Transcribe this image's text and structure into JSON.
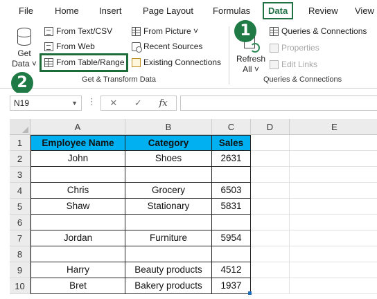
{
  "menu": {
    "tabs": [
      "File",
      "Home",
      "Insert",
      "Page Layout",
      "Formulas",
      "Data",
      "Review",
      "View"
    ],
    "active_tab": "Data"
  },
  "ribbon": {
    "get_data": {
      "line1": "Get",
      "line2": "Data ˅"
    },
    "from_text_csv": "From Text/CSV",
    "from_web": "From Web",
    "from_table_range": "From Table/Range",
    "from_picture": "From Picture ˅",
    "recent_sources": "Recent Sources",
    "existing_connections": "Existing Connections",
    "group_get_transform": "Get & Transform Data",
    "refresh": {
      "line1": "Refresh",
      "line2": "All ˅"
    },
    "queries_connections": "Queries & Connections",
    "properties": "Properties",
    "edit_links": "Edit Links",
    "group_queries": "Queries & Connections"
  },
  "annotations": {
    "step1": "1",
    "step2": "2",
    "highlight_color": "#1e6b3a"
  },
  "formula_bar": {
    "name_box": "N19",
    "dropdown": "▼",
    "dots": "⋮",
    "cancel": "✕",
    "enter": "✓",
    "fx": "fx",
    "formula": ""
  },
  "sheet": {
    "columns": [
      "A",
      "B",
      "C",
      "D",
      "E"
    ],
    "rows": [
      "1",
      "2",
      "3",
      "4",
      "5",
      "6",
      "7",
      "8",
      "9",
      "10"
    ],
    "header_fill": "#00b0f0",
    "table": [
      [
        "Employee Name",
        "Category",
        "Sales"
      ],
      [
        "John",
        "Shoes",
        "2631"
      ],
      [
        "",
        "",
        ""
      ],
      [
        "Chris",
        "Grocery",
        "6503"
      ],
      [
        "Shaw",
        "Stationary",
        "5831"
      ],
      [
        "",
        "",
        ""
      ],
      [
        "Jordan",
        "Furniture",
        "5954"
      ],
      [
        "",
        "",
        ""
      ],
      [
        "Harry",
        "Beauty products",
        "4512"
      ],
      [
        "Bret",
        "Bakery products",
        "1937"
      ]
    ]
  }
}
